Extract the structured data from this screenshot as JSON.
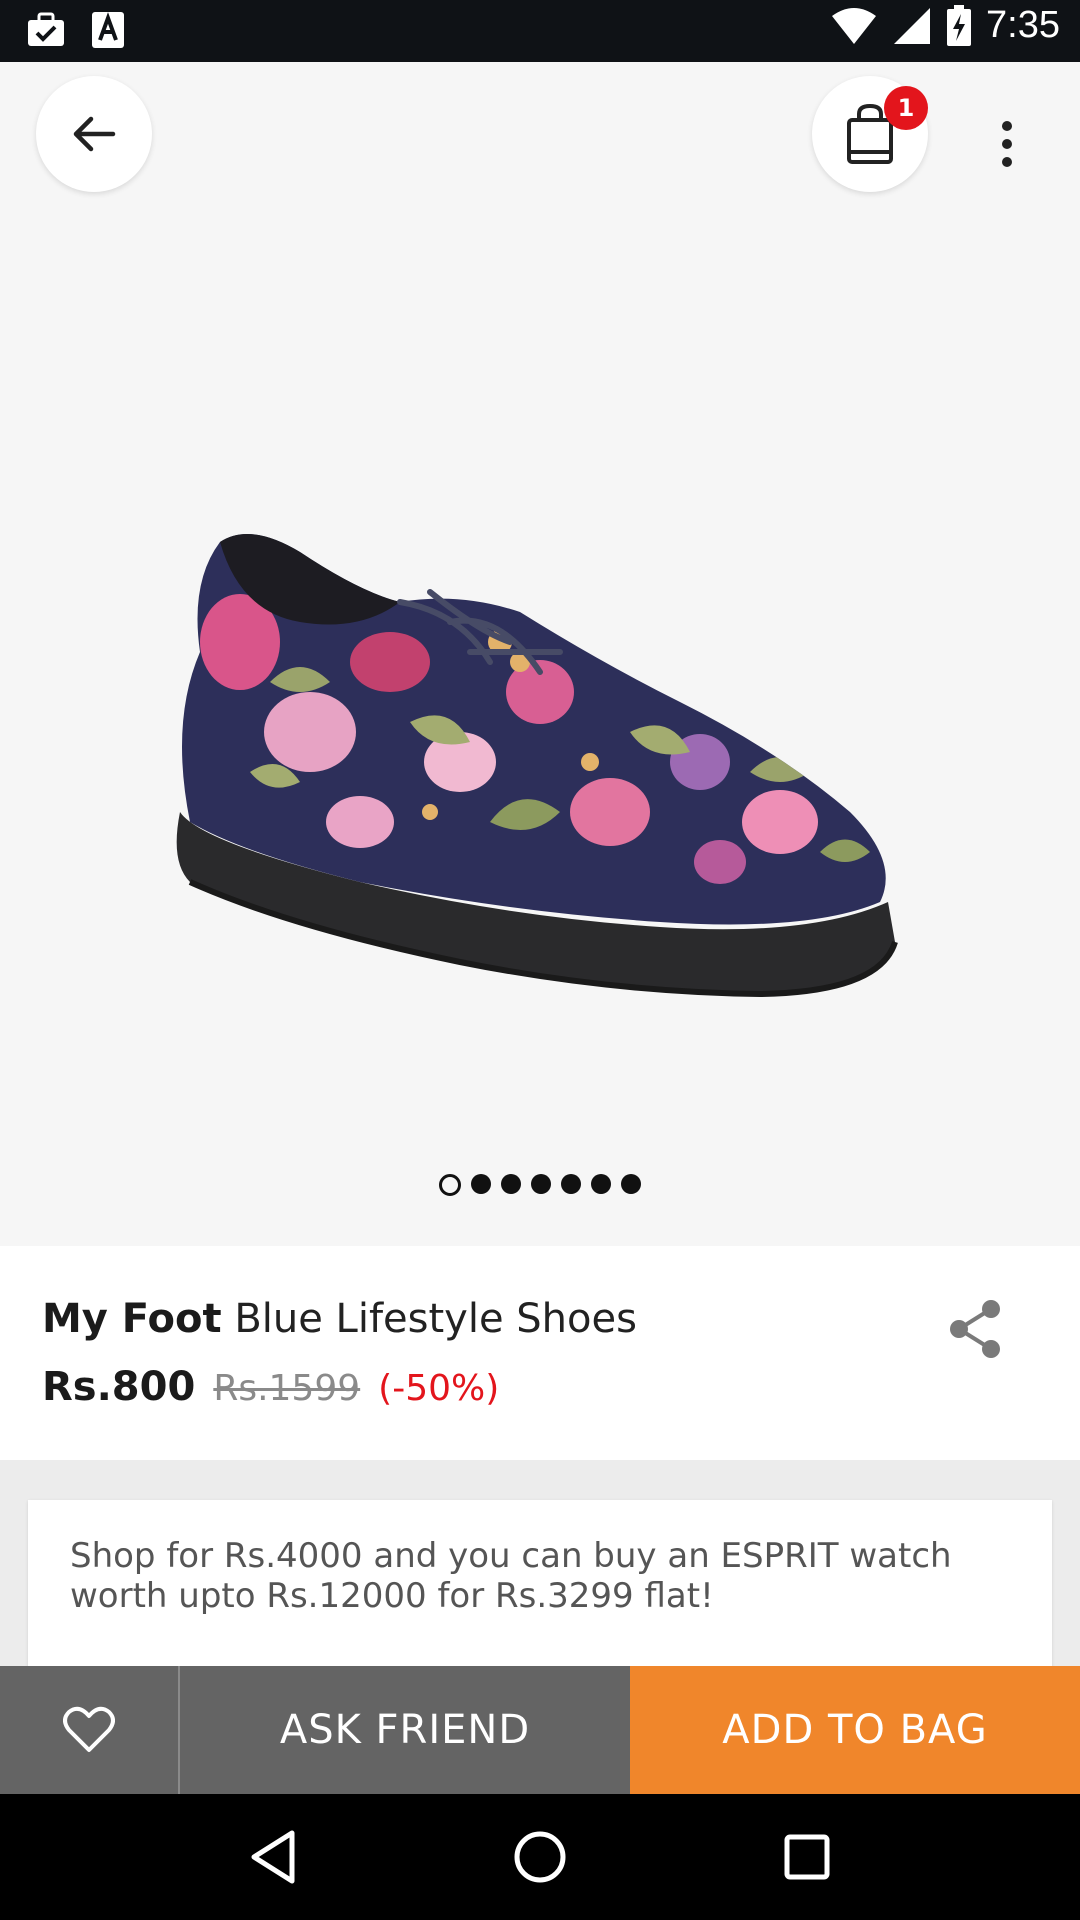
{
  "status_bar": {
    "time": "7:35",
    "icons": [
      "briefcase-check-icon",
      "font-a-icon",
      "wifi-icon",
      "signal-icon",
      "battery-charging-icon"
    ]
  },
  "header": {
    "back_icon": "arrow-left-icon",
    "bag_icon": "shopping-bag-icon",
    "bag_count": "1",
    "more_icon": "more-vertical-icon"
  },
  "gallery": {
    "image": "floral-shoe-image",
    "page_count": 7,
    "current_page": 1
  },
  "product": {
    "brand": "My Foot",
    "name": "Blue Lifestyle Shoes",
    "price": "Rs.800",
    "mrp": "Rs.1599",
    "discount": "(-50%)",
    "share_icon": "share-icon"
  },
  "offer": {
    "text": "Shop for Rs.4000 and you can buy an ESPRIT watch worth upto Rs.12000 for Rs.3299 flat!"
  },
  "actions": {
    "wishlist_icon": "heart-icon",
    "ask_friend": "ASK FRIEND",
    "add_to_bag": "ADD TO BAG"
  },
  "nav": {
    "back_icon": "nav-back-icon",
    "home_icon": "nav-home-icon",
    "recents_icon": "nav-recents-icon"
  },
  "colors": {
    "accent": "#f0862b",
    "discount": "#e3151c",
    "action_gray": "#646464"
  }
}
